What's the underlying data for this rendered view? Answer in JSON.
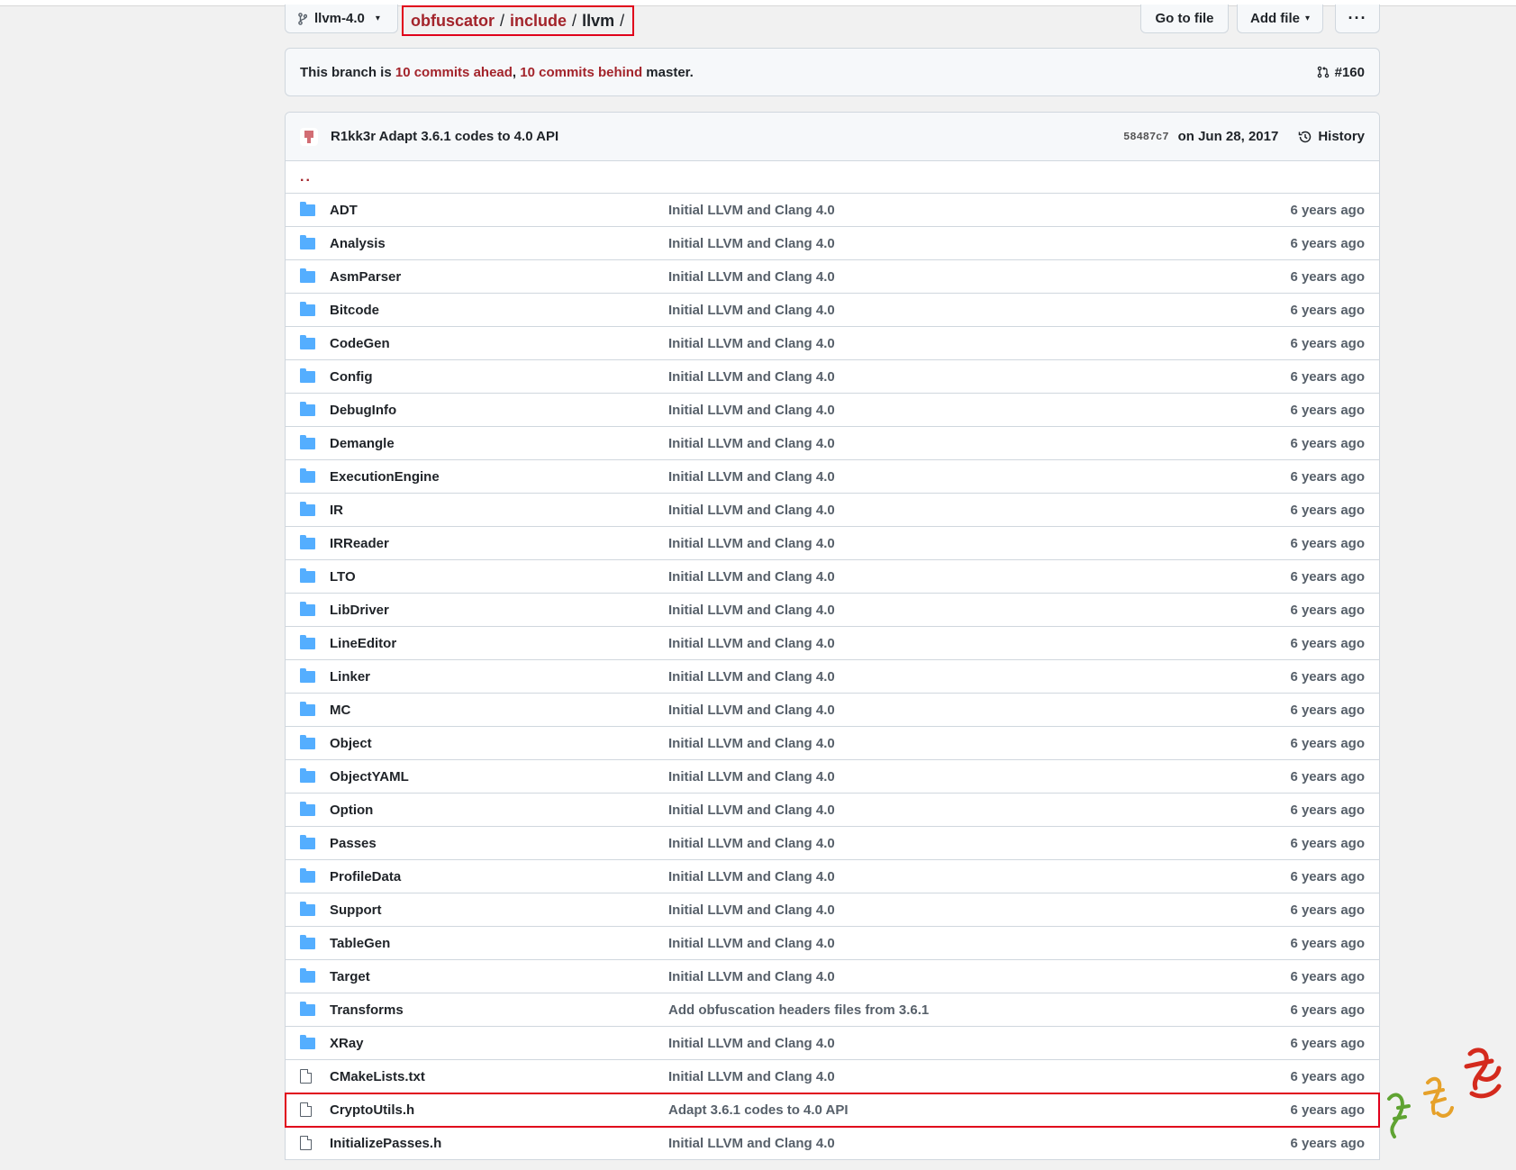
{
  "branch": {
    "name": "llvm-4.0"
  },
  "breadcrumb": {
    "part1": "obfuscator",
    "part2": "include",
    "current": "llvm",
    "separator": "/"
  },
  "buttons": {
    "go_to_file": "Go to file",
    "add_file": "Add file",
    "more": "···"
  },
  "ahead_banner": {
    "prefix": "This branch is ",
    "ahead": "10 commits ahead",
    "comma": ", ",
    "behind": "10 commits behind",
    "suffix": " master.",
    "pr": "#160"
  },
  "latest_commit": {
    "author_and_message": "R1kk3r Adapt 3.6.1 codes to 4.0 API",
    "sha": "58487c7",
    "date": "on Jun 28, 2017",
    "history_label": "History"
  },
  "parent_dir": "..",
  "files": [
    {
      "type": "dir",
      "name": "ADT",
      "msg": "Initial LLVM and Clang 4.0",
      "age": "6 years ago"
    },
    {
      "type": "dir",
      "name": "Analysis",
      "msg": "Initial LLVM and Clang 4.0",
      "age": "6 years ago"
    },
    {
      "type": "dir",
      "name": "AsmParser",
      "msg": "Initial LLVM and Clang 4.0",
      "age": "6 years ago"
    },
    {
      "type": "dir",
      "name": "Bitcode",
      "msg": "Initial LLVM and Clang 4.0",
      "age": "6 years ago"
    },
    {
      "type": "dir",
      "name": "CodeGen",
      "msg": "Initial LLVM and Clang 4.0",
      "age": "6 years ago"
    },
    {
      "type": "dir",
      "name": "Config",
      "msg": "Initial LLVM and Clang 4.0",
      "age": "6 years ago"
    },
    {
      "type": "dir",
      "name": "DebugInfo",
      "msg": "Initial LLVM and Clang 4.0",
      "age": "6 years ago"
    },
    {
      "type": "dir",
      "name": "Demangle",
      "msg": "Initial LLVM and Clang 4.0",
      "age": "6 years ago"
    },
    {
      "type": "dir",
      "name": "ExecutionEngine",
      "msg": "Initial LLVM and Clang 4.0",
      "age": "6 years ago"
    },
    {
      "type": "dir",
      "name": "IR",
      "msg": "Initial LLVM and Clang 4.0",
      "age": "6 years ago"
    },
    {
      "type": "dir",
      "name": "IRReader",
      "msg": "Initial LLVM and Clang 4.0",
      "age": "6 years ago"
    },
    {
      "type": "dir",
      "name": "LTO",
      "msg": "Initial LLVM and Clang 4.0",
      "age": "6 years ago"
    },
    {
      "type": "dir",
      "name": "LibDriver",
      "msg": "Initial LLVM and Clang 4.0",
      "age": "6 years ago"
    },
    {
      "type": "dir",
      "name": "LineEditor",
      "msg": "Initial LLVM and Clang 4.0",
      "age": "6 years ago"
    },
    {
      "type": "dir",
      "name": "Linker",
      "msg": "Initial LLVM and Clang 4.0",
      "age": "6 years ago"
    },
    {
      "type": "dir",
      "name": "MC",
      "msg": "Initial LLVM and Clang 4.0",
      "age": "6 years ago"
    },
    {
      "type": "dir",
      "name": "Object",
      "msg": "Initial LLVM and Clang 4.0",
      "age": "6 years ago"
    },
    {
      "type": "dir",
      "name": "ObjectYAML",
      "msg": "Initial LLVM and Clang 4.0",
      "age": "6 years ago"
    },
    {
      "type": "dir",
      "name": "Option",
      "msg": "Initial LLVM and Clang 4.0",
      "age": "6 years ago"
    },
    {
      "type": "dir",
      "name": "Passes",
      "msg": "Initial LLVM and Clang 4.0",
      "age": "6 years ago"
    },
    {
      "type": "dir",
      "name": "ProfileData",
      "msg": "Initial LLVM and Clang 4.0",
      "age": "6 years ago"
    },
    {
      "type": "dir",
      "name": "Support",
      "msg": "Initial LLVM and Clang 4.0",
      "age": "6 years ago"
    },
    {
      "type": "dir",
      "name": "TableGen",
      "msg": "Initial LLVM and Clang 4.0",
      "age": "6 years ago"
    },
    {
      "type": "dir",
      "name": "Target",
      "msg": "Initial LLVM and Clang 4.0",
      "age": "6 years ago"
    },
    {
      "type": "dir",
      "name": "Transforms",
      "msg": "Add obfuscation headers files from 3.6.1",
      "age": "6 years ago"
    },
    {
      "type": "dir",
      "name": "XRay",
      "msg": "Initial LLVM and Clang 4.0",
      "age": "6 years ago"
    },
    {
      "type": "file",
      "name": "CMakeLists.txt",
      "msg": "Initial LLVM and Clang 4.0",
      "age": "6 years ago"
    },
    {
      "type": "file",
      "name": "CryptoUtils.h",
      "msg": "Adapt 3.6.1 codes to 4.0 API",
      "age": "6 years ago",
      "highlighted": true
    },
    {
      "type": "file",
      "name": "InitializePasses.h",
      "msg": "Initial LLVM and Clang 4.0",
      "age": "6 years ago"
    }
  ],
  "colors": {
    "link_red": "#a3242b",
    "highlight_box": "#e0001b",
    "folder_blue": "#54aeff"
  },
  "icons": {
    "branch": "git-branch-icon",
    "pull_request": "pull-request-icon",
    "history": "clock-history-icon",
    "folder": "folder-icon",
    "file": "file-icon"
  }
}
